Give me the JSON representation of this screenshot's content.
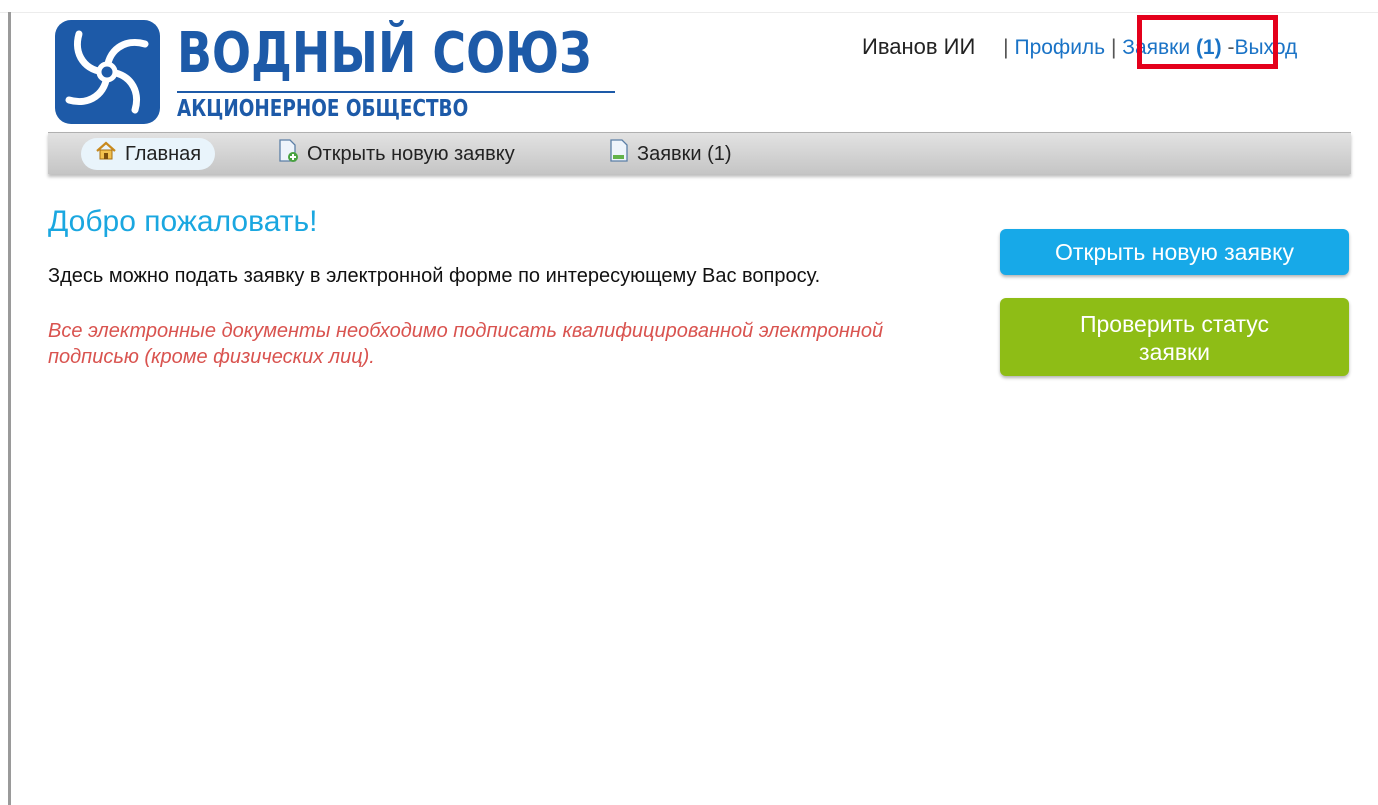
{
  "logo": {
    "title": "ВОДНЫЙ СОЮЗ",
    "subtitle": "АКЦИОНЕРНОЕ ОБЩЕСТВО",
    "brand_color": "#1d5aa8"
  },
  "userbar": {
    "username": "Иванов ИИ",
    "separator": "|",
    "profile": "Профиль",
    "requests_label": "Заявки",
    "requests_count": "(1)",
    "dash": "-",
    "logout": "Выход"
  },
  "nav": {
    "items": [
      {
        "label": "Главная",
        "icon": "home-icon"
      },
      {
        "label": "Открыть новую заявку",
        "icon": "new-document-icon"
      },
      {
        "label": "Заявки (1)",
        "icon": "document-icon"
      }
    ]
  },
  "main": {
    "welcome": "Добро пожаловать!",
    "intro": "Здесь можно подать заявку в электронной форме по интересующему Вас вопросу.",
    "note": "Все электронные документы необходимо подписать квалифицированной электронной подписью (кроме физических лиц)."
  },
  "actions": {
    "open_request": "Открыть новую заявку",
    "check_status_line1": "Проверить статус",
    "check_status_line2": "заявки"
  },
  "colors": {
    "accent_blue": "#17a9e8",
    "accent_green": "#8ebd16",
    "note_red": "#d9534f",
    "highlight_red": "#e4001b"
  }
}
